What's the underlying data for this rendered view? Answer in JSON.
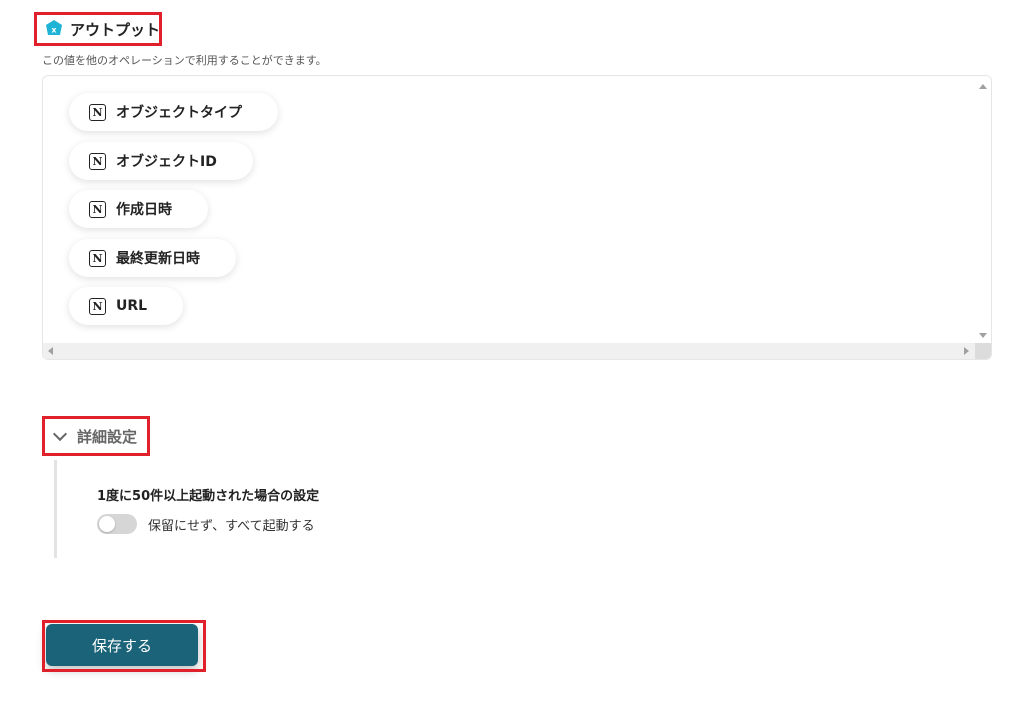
{
  "output": {
    "title": "アウトプット",
    "description": "この値を他のオペレーションで利用することができます。",
    "items": [
      {
        "label": "オブジェクトタイプ",
        "icon": "notion-icon"
      },
      {
        "label": "オブジェクトID",
        "icon": "notion-icon"
      },
      {
        "label": "作成日時",
        "icon": "notion-icon"
      },
      {
        "label": "最終更新日時",
        "icon": "notion-icon"
      },
      {
        "label": "URL",
        "icon": "notion-icon"
      }
    ]
  },
  "advanced": {
    "title": "詳細設定",
    "setting_label": "1度に50件以上起動された場合の設定",
    "toggle_label": "保留にせず、すべて起動する",
    "toggle_on": false
  },
  "save_button": "保存する",
  "colors": {
    "highlight": "#e0202a",
    "save_button": "#1a6378",
    "output_icon": "#1fb3d6"
  }
}
